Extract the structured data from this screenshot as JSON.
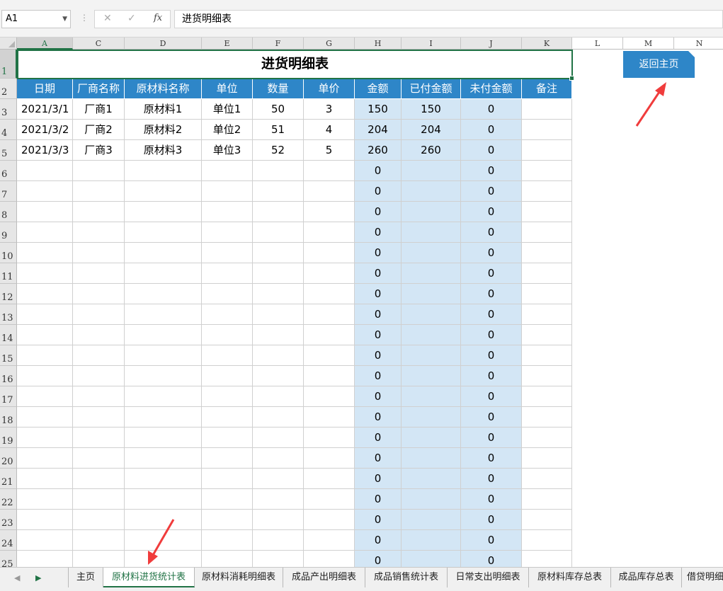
{
  "formula_bar": {
    "name_box": "A1",
    "cancel_icon": "✕",
    "enter_icon": "✓",
    "fx_icon": "fx",
    "formula": "进货明细表"
  },
  "columns": [
    "A",
    "C",
    "D",
    "E",
    "F",
    "G",
    "H",
    "I",
    "J",
    "K",
    "L",
    "M",
    "N"
  ],
  "rows": [
    "1",
    "2",
    "3",
    "4",
    "5",
    "6",
    "7",
    "8",
    "9",
    "10",
    "11",
    "12",
    "13",
    "14",
    "15",
    "16",
    "17",
    "18",
    "19",
    "20",
    "21",
    "22",
    "23",
    "24",
    "25"
  ],
  "sheet": {
    "title": "进货明细表",
    "headers": [
      "日期",
      "厂商名称",
      "原材料名称",
      "单位",
      "数量",
      "单价",
      "金额",
      "已付金额",
      "未付金额",
      "备注"
    ],
    "data_rows": [
      [
        "2021/3/1",
        "厂商1",
        "原材料1",
        "单位1",
        "50",
        "3",
        "150",
        "150",
        "0",
        ""
      ],
      [
        "2021/3/2",
        "厂商2",
        "原材料2",
        "单位2",
        "51",
        "4",
        "204",
        "204",
        "0",
        ""
      ],
      [
        "2021/3/3",
        "厂商3",
        "原材料3",
        "单位3",
        "52",
        "5",
        "260",
        "260",
        "0",
        ""
      ]
    ],
    "empty_amount": "0",
    "empty_unpaid": "0"
  },
  "home_button": "返回主页",
  "tabs": [
    "主页",
    "原材料进货统计表",
    "原材料消耗明细表",
    "成品产出明细表",
    "成品销售统计表",
    "日常支出明细表",
    "原材料库存总表",
    "成品库存总表",
    "借贷明细"
  ],
  "active_tab": 1,
  "accent_color": "#217346",
  "header_color": "#2e86c8",
  "highlight_color": "#d3e6f5",
  "annotation_color": "#f03c3c"
}
